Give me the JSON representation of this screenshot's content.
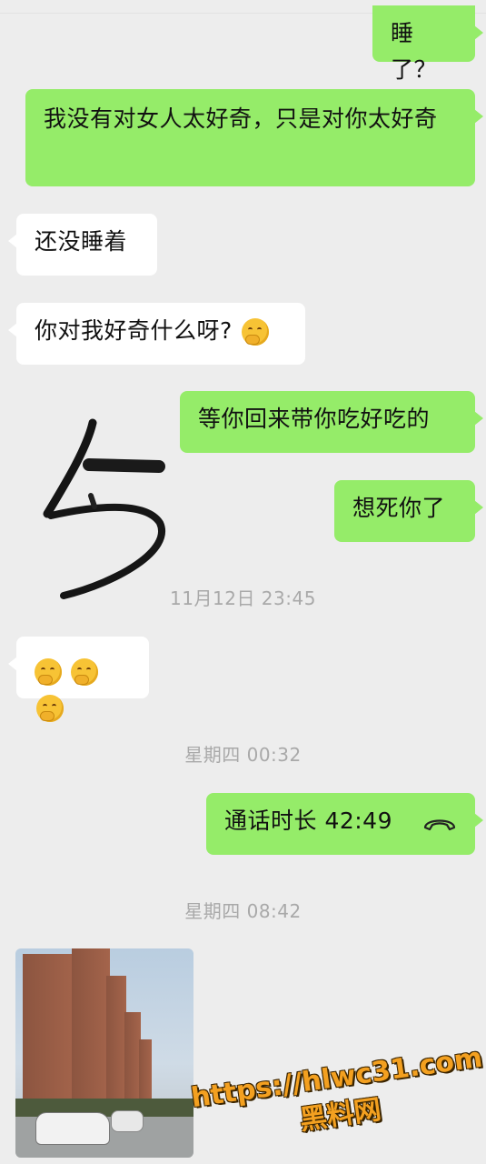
{
  "messages": {
    "m1": "睡了？",
    "m2": "我没有对女人太好奇，只是对你太好奇",
    "m3": "还没睡着",
    "m4": "你对我好奇什么呀?",
    "m5": "等你回来带你吃好吃的",
    "m6": "想死你了"
  },
  "stamps": {
    "s1": "11月12日 23:45",
    "s2": "星期四 00:32",
    "s3": "星期四 08:42"
  },
  "call": {
    "label": "通话时长 42:49",
    "icon": "phone-hangup-icon"
  },
  "emoji": {
    "shushing": "shushing-face-icon",
    "yawning": "yawning-face-icon"
  },
  "watermark": {
    "url": "https://hlwc31.com",
    "name": "黑料网"
  },
  "colors": {
    "sent_bubble": "#95ec69",
    "received_bubble": "#ffffff",
    "background": "#ededed",
    "watermark": "#f3a020"
  }
}
